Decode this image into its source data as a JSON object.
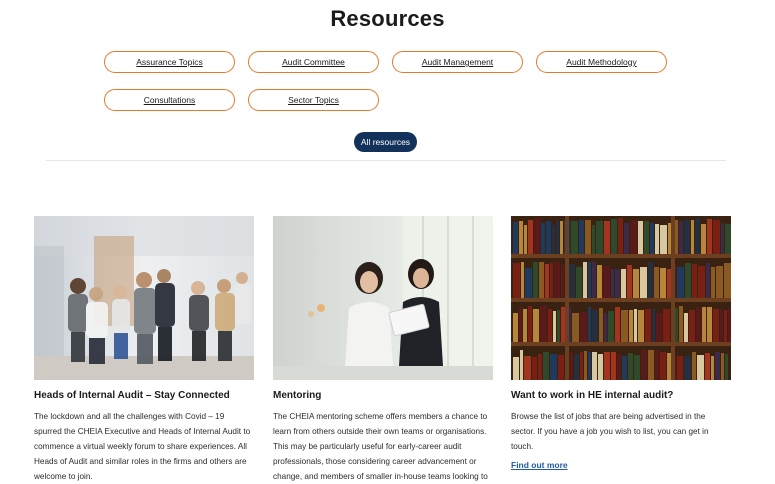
{
  "page": {
    "title": "Resources"
  },
  "topics": [
    "Assurance Topics",
    "Audit Committee",
    "Audit Management",
    "Audit Methodology",
    "Consultations",
    "Sector Topics"
  ],
  "all_resources_label": "All resources",
  "cards": [
    {
      "title": "Heads of Internal Audit – Stay Connected",
      "body": "The lockdown and all the challenges with Covid – 19 spurred the CHEIA Executive and Heads of Internal Audit to commence a virtual weekly forum to share experiences. All Heads of Audit and similar roles in the firms and others are welcome to join.",
      "image": "networking-event-photo"
    },
    {
      "title": "Mentoring",
      "body": "The CHEIA mentoring scheme offers members a chance to learn from others outside their own teams or organisations. This may be particularly useful for early-career audit professionals, those considering career advancement or change, and members of smaller in-house teams looking to",
      "image": "mentoring-tablet-photo"
    },
    {
      "title": "Want to work in HE internal audit?",
      "body": "Browse the list of jobs that are being advertised in the sector. If you have a job you wish to list, you can get in touch.",
      "link": "Find out more",
      "image": "bookshelf-photo"
    }
  ],
  "colors": {
    "accent": "#e8782b",
    "navy": "#13325b",
    "link": "#1f5aa6"
  }
}
